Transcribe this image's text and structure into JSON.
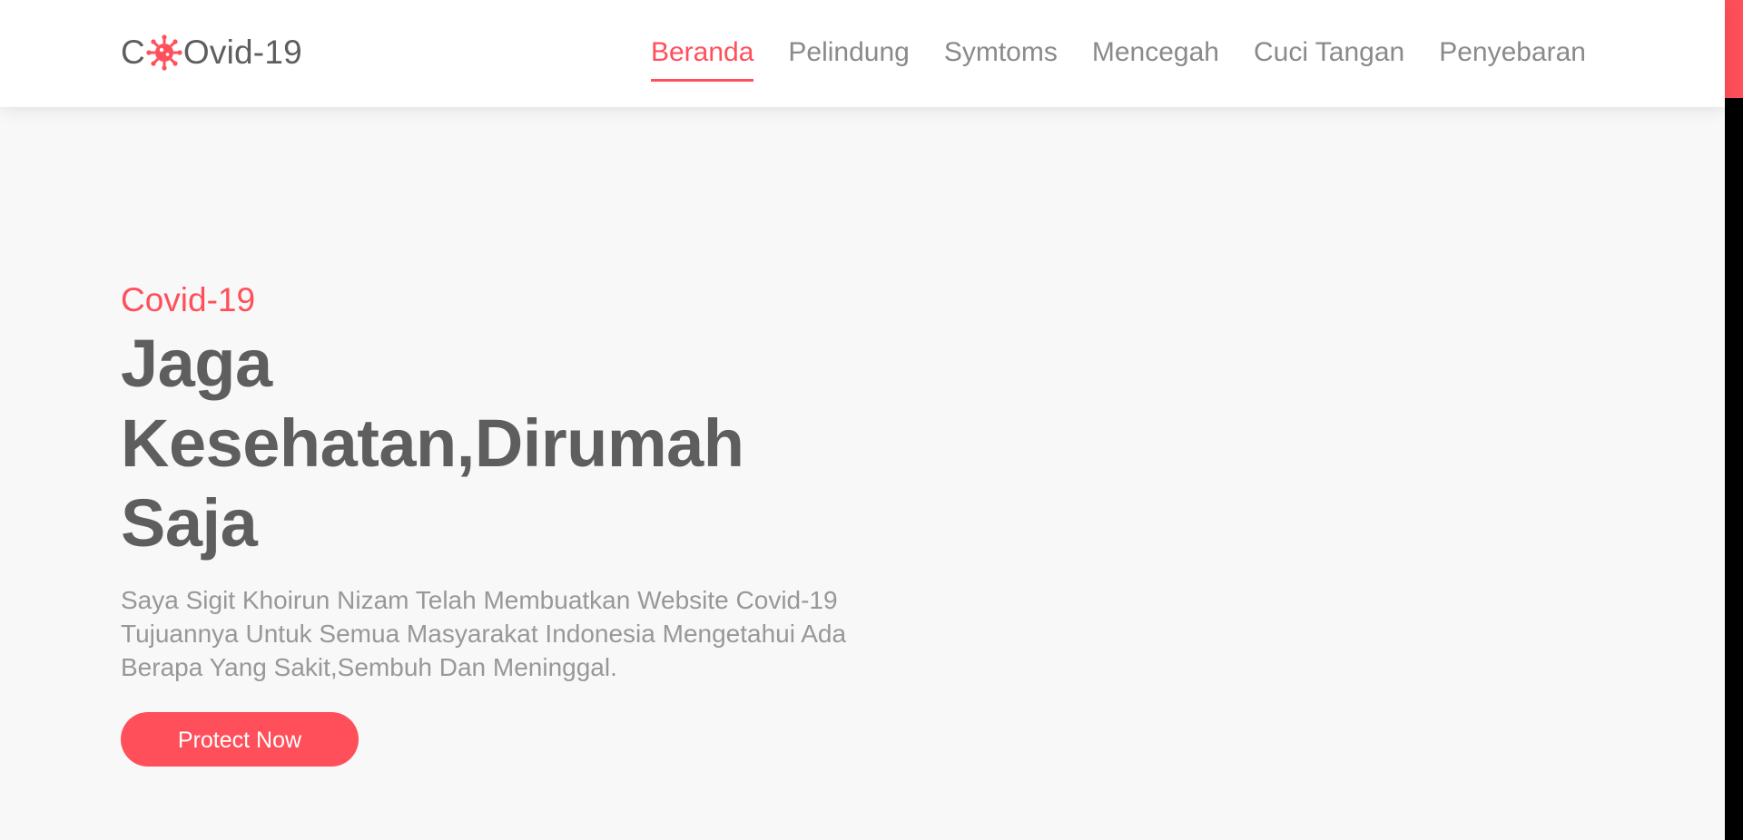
{
  "header": {
    "logo": {
      "prefix": "C",
      "suffix": "Ovid-19",
      "icon": "virus-icon"
    },
    "nav": [
      {
        "label": "Beranda",
        "active": true
      },
      {
        "label": "Pelindung",
        "active": false
      },
      {
        "label": "Symtoms",
        "active": false
      },
      {
        "label": "Mencegah",
        "active": false
      },
      {
        "label": "Cuci Tangan",
        "active": false
      },
      {
        "label": "Penyebaran",
        "active": false
      }
    ]
  },
  "hero": {
    "eyebrow": "Covid-19",
    "title_line1": "Jaga",
    "title_line2": "Kesehatan,Dirumah Saja",
    "description": "Saya Sigit Khoirun Nizam Telah Membuatkan Website Covid-19 Tujuannya Untuk Semua Masyarakat Indonesia Mengetahui Ada Berapa Yang Sakit,Sembuh Dan Meninggal.",
    "cta_label": "Protect Now"
  },
  "colors": {
    "accent": "#ff4f5a",
    "text_dark": "#5e5e5e",
    "text_muted": "#8a8a8a",
    "background": "#f8f8f8",
    "header_bg": "#ffffff"
  }
}
